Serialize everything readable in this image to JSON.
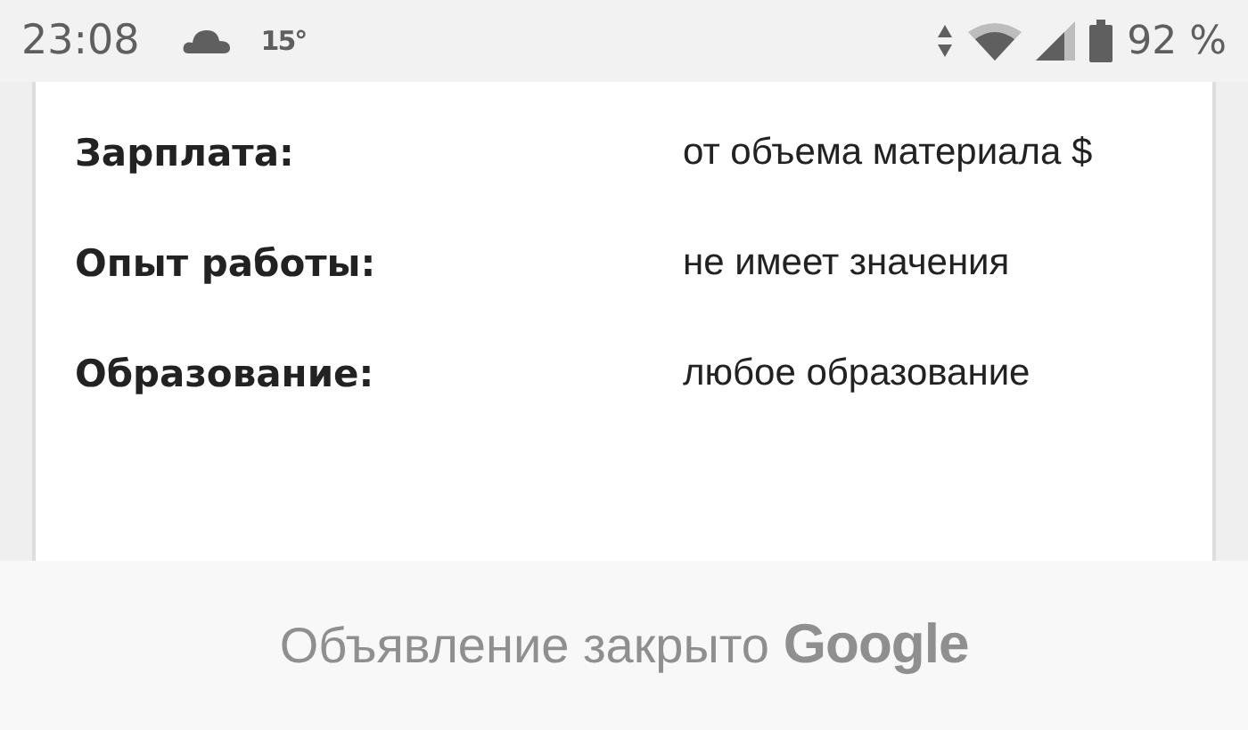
{
  "status_bar": {
    "time": "23:08",
    "temperature": "15°",
    "battery": "92 %"
  },
  "details": [
    {
      "label": "Зарплата:",
      "value": "от объема материала $"
    },
    {
      "label": "Опыт работы:",
      "value": "не имеет значения"
    },
    {
      "label": "Образование:",
      "value": "любое образование"
    }
  ],
  "ad_banner": {
    "text": "Объявление закрыто",
    "brand": "Google"
  }
}
